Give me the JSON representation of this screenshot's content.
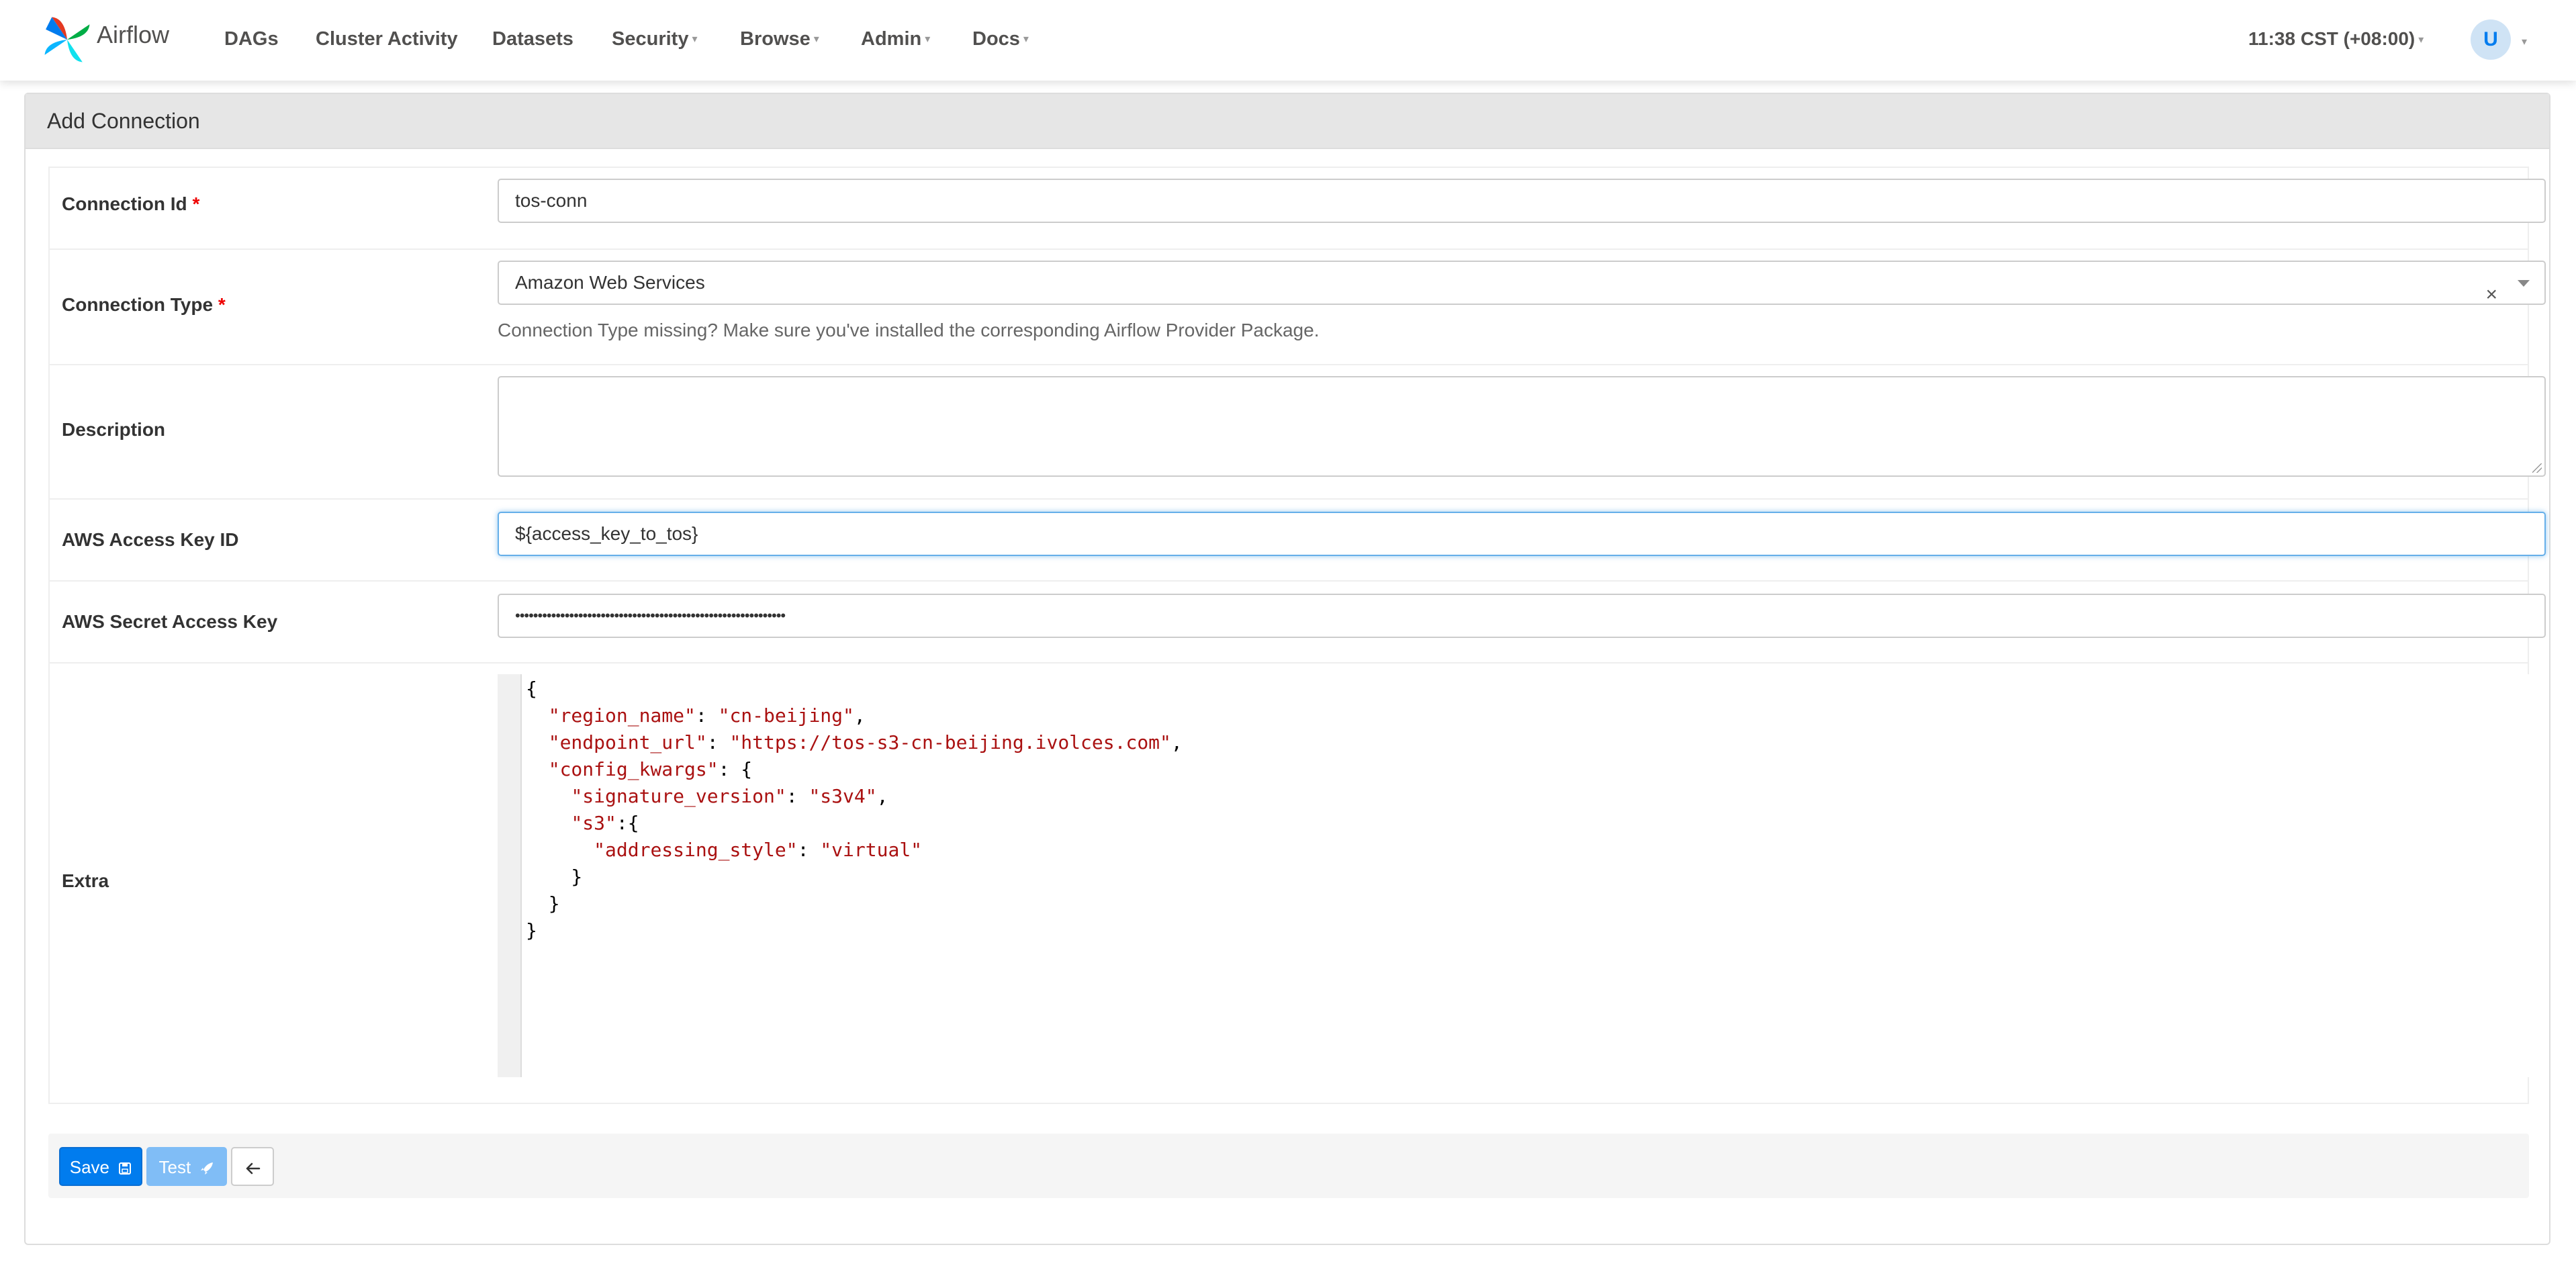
{
  "app": {
    "name": "Airflow"
  },
  "nav": {
    "items": [
      "DAGs",
      "Cluster Activity",
      "Datasets",
      "Security",
      "Browse",
      "Admin",
      "Docs"
    ],
    "time": "11:38 CST (+08:00)",
    "user_initial": "U"
  },
  "panel": {
    "title": "Add Connection"
  },
  "form": {
    "conn_id": {
      "label": "Connection Id",
      "required_mark": "*",
      "value": "tos-conn"
    },
    "conn_type": {
      "label": "Connection Type",
      "required_mark": "*",
      "value": "Amazon Web Services",
      "clear": "×",
      "help": "Connection Type missing? Make sure you've installed the corresponding Airflow Provider Package."
    },
    "description": {
      "label": "Description",
      "value": ""
    },
    "access_key": {
      "label": "AWS Access Key ID",
      "value": "${access_key_to_tos}"
    },
    "secret_key": {
      "label": "AWS Secret Access Key",
      "value": "••••••••••••••••••••••••••••••••••••••••••••••••••••••••••••"
    },
    "extra": {
      "label": "Extra",
      "lines": [
        "{",
        "  \"region_name\": \"cn-beijing\",",
        "  \"endpoint_url\": \"https://tos-s3-cn-beijing.ivolces.com\",",
        "  \"config_kwargs\": {",
        "    \"signature_version\": \"s3v4\",",
        "    \"s3\":{",
        "      \"addressing_style\": \"virtual\"",
        "    }",
        "  }",
        "}"
      ]
    }
  },
  "buttons": {
    "save": "Save",
    "test": "Test"
  },
  "colors": {
    "primary": "#017cee",
    "test_disabled": "#80bdf6",
    "json_string": "#aa1111"
  }
}
